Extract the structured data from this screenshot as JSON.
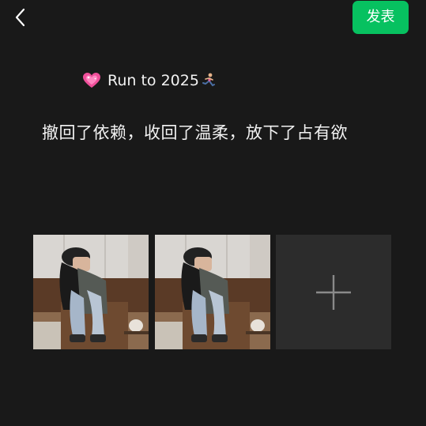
{
  "header": {
    "back_icon": "chevron-left-icon",
    "publish_label": "发表",
    "accent_color": "#07c160"
  },
  "post": {
    "title_text": "Run to 2025",
    "title_emoji_left": "sparkling-heart",
    "title_emoji_right": "running-woman",
    "body_text": "撤回了依赖，收回了温柔，放下了占有欲"
  },
  "photos": [
    {
      "description_icon": "photo-thumbnail"
    },
    {
      "description_icon": "photo-thumbnail"
    }
  ],
  "add_photo": {
    "icon": "plus-icon"
  }
}
